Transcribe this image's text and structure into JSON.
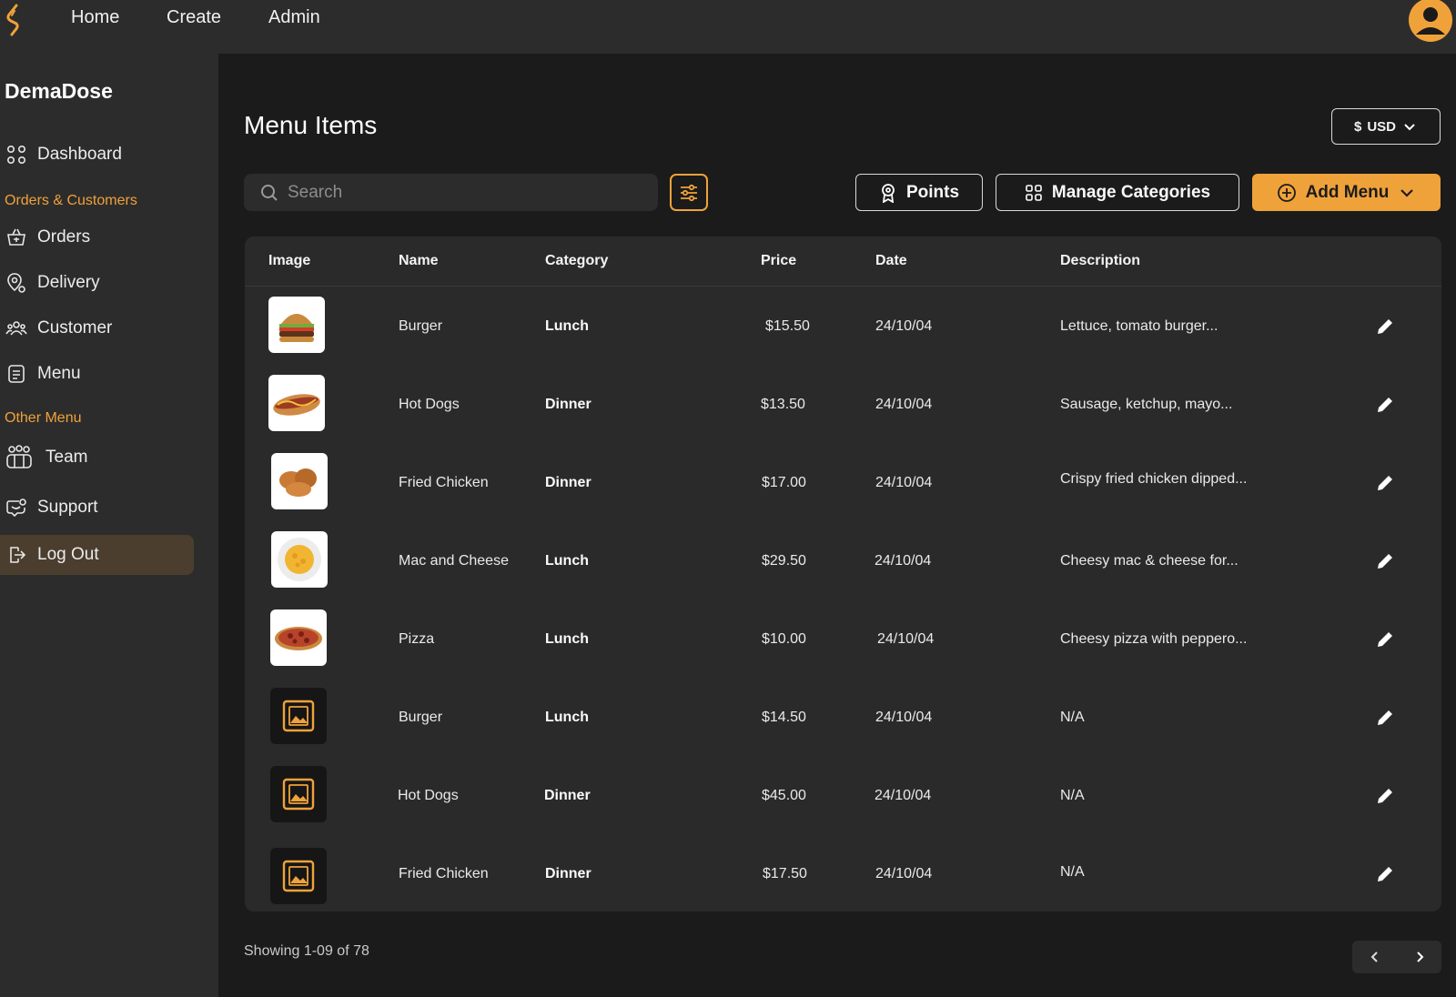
{
  "topnav": {
    "items": [
      "Home",
      "Create",
      "Admin"
    ]
  },
  "sidebar": {
    "brand": "DemaDose",
    "dashboard": "Dashboard",
    "section1": "Orders & Customers",
    "orders": "Orders",
    "delivery": "Delivery",
    "customer": "Customer",
    "menu": "Menu",
    "section2": "Other Menu",
    "team": "Team",
    "support": "Support",
    "logout": "Log Out"
  },
  "main": {
    "title": "Menu Items",
    "currency": "USD",
    "currency_symbol": "$",
    "search_placeholder": "Search",
    "points": "Points",
    "manage_categories": "Manage Categories",
    "add_menu": "Add Menu"
  },
  "table": {
    "headers": [
      "Image",
      "Name",
      "Category",
      "Price",
      "Date",
      "Description"
    ],
    "rows": [
      {
        "name": "Burger",
        "category": "Lunch",
        "price": "$15.50",
        "date": "24/10/04",
        "description": "Lettuce, tomato burger...",
        "image": "burger"
      },
      {
        "name": "Hot Dogs",
        "category": "Dinner",
        "price": "$13.50",
        "date": "24/10/04",
        "description": "Sausage, ketchup, mayo...",
        "image": "hotdog"
      },
      {
        "name": "Fried Chicken",
        "category": "Dinner",
        "price": "$17.00",
        "date": "24/10/04",
        "description": "Crispy fried chicken dipped...",
        "image": "chicken"
      },
      {
        "name": "Mac and Cheese",
        "category": "Lunch",
        "price": "$29.50",
        "date": "24/10/04",
        "description": "Cheesy mac & cheese for...",
        "image": "mac"
      },
      {
        "name": "Pizza",
        "category": "Lunch",
        "price": "$10.00",
        "date": "24/10/04",
        "description": "Cheesy pizza with peppero...",
        "image": "pizza"
      },
      {
        "name": "Burger",
        "category": "Lunch",
        "price": "$14.50",
        "date": "24/10/04",
        "description": "N/A",
        "image": "placeholder"
      },
      {
        "name": "Hot Dogs",
        "category": "Dinner",
        "price": "$45.00",
        "date": "24/10/04",
        "description": "N/A",
        "image": "placeholder"
      },
      {
        "name": "Fried Chicken",
        "category": "Dinner",
        "price": "$17.50",
        "date": "24/10/04",
        "description": "N/A",
        "image": "placeholder"
      }
    ]
  },
  "footer": {
    "showing": "Showing 1-09 of 78"
  },
  "colors": {
    "accent": "#f0a23a",
    "bg": "#1b1b1b",
    "panel": "#2c2c2c"
  }
}
